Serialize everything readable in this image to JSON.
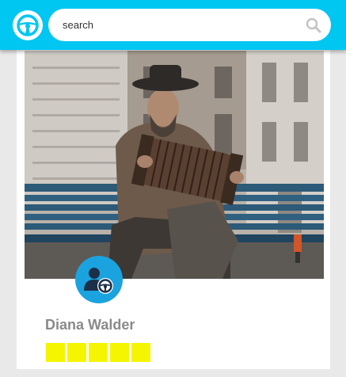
{
  "search": {
    "placeholder": "search",
    "value": ""
  },
  "profile": {
    "name": "Diana Walder",
    "rating": 5,
    "rating_max": 5
  },
  "colors": {
    "header": "#00c6f2",
    "avatar": "#1aa3df",
    "star": "#f5f500",
    "name": "#8a8a8a"
  },
  "icons": {
    "logo": "steering-wheel-icon",
    "search": "search-icon",
    "avatar": "user-driver-icon"
  }
}
